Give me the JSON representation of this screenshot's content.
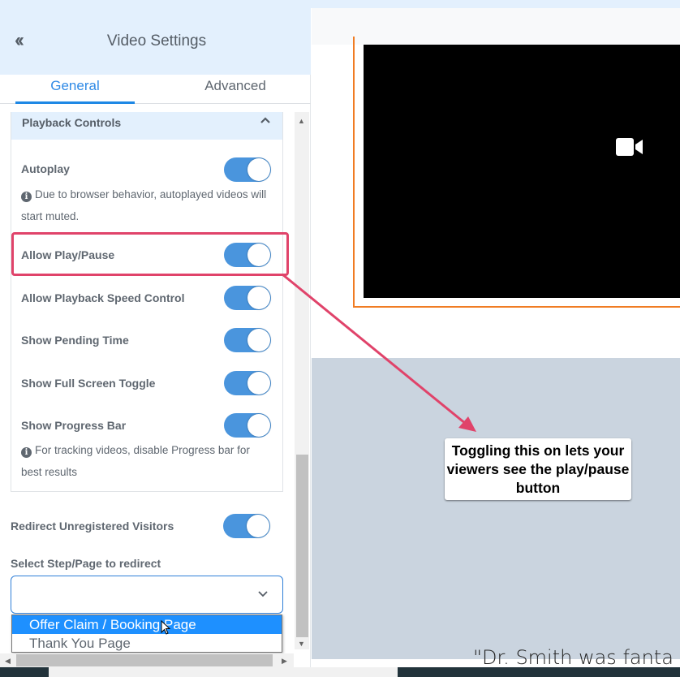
{
  "header": {
    "title": "Video Settings",
    "back_icon": "double-chevron-left-icon"
  },
  "tabs": [
    {
      "label": "General",
      "active": true
    },
    {
      "label": "Advanced",
      "active": false
    }
  ],
  "section": {
    "title": "Playback Controls",
    "expanded": true
  },
  "settings": [
    {
      "label": "Autoplay",
      "on": true,
      "note": "Due to browser behavior, autoplayed videos will start muted."
    },
    {
      "label": "Allow Play/Pause",
      "on": true,
      "highlighted": true
    },
    {
      "label": "Allow Playback Speed Control",
      "on": true
    },
    {
      "label": "Show Pending Time",
      "on": true
    },
    {
      "label": "Show Full Screen Toggle",
      "on": true
    },
    {
      "label": "Show Progress Bar",
      "on": true,
      "note": "For tracking videos, disable Progress bar for best results"
    }
  ],
  "redirect": {
    "label": "Redirect Unregistered Visitors",
    "on": true
  },
  "select": {
    "label": "Select Step/Page to redirect",
    "value": "",
    "options": [
      "Offer Claim / Booking Page",
      "Thank You Page"
    ],
    "hovered": "Offer Claim / Booking Page"
  },
  "tooltip": {
    "text": "Toggling this on lets your viewers see the play/pause button"
  },
  "preview": {
    "quote": "\"Dr. Smith was fanta"
  },
  "colors": {
    "accent": "#1e88e5",
    "toggle": "#4a95dd",
    "highlight": "#e0436a",
    "border_orange": "#f07c23"
  }
}
